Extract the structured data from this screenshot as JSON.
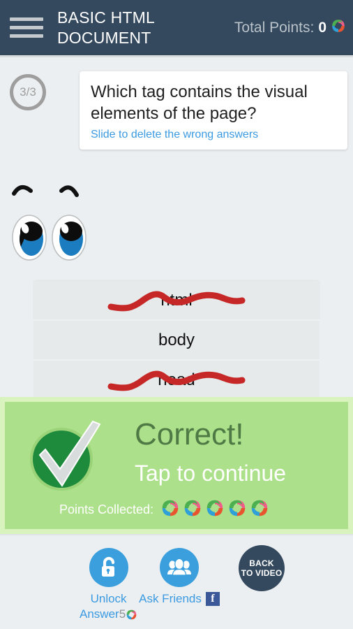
{
  "header": {
    "menu_icon": "hamburger-menu-icon",
    "title": "BASIC HTML DOCUMENT",
    "points_label": "Total Points:",
    "points_value": "0",
    "points_icon": "swirl-points-icon",
    "background_color": "#34495e"
  },
  "question": {
    "progress": "3/3",
    "text": "Which tag contains the visual elements of the page?",
    "hint": "Slide to delete the wrong answers",
    "hint_color": "#3b9ae1"
  },
  "character": {
    "face_icon": "cartoon-eyes-face"
  },
  "answers": [
    {
      "label": "html",
      "struck": true
    },
    {
      "label": "body",
      "struck": false
    },
    {
      "label": "head",
      "struck": true
    }
  ],
  "result_banner": {
    "icon": "green-check-badge-icon",
    "title": "Correct!",
    "subtitle": "Tap to continue",
    "points_collected_label": "Points Collected:",
    "points_collected_count": 5,
    "title_color": "#4f7a45",
    "panel_color": "#ace08a",
    "border_color": "#d8f3bd"
  },
  "bottom_actions": [
    {
      "id": "unlock-answer",
      "icon": "open-padlock-icon",
      "label_line1": "Unlock",
      "label_line2": "Answer",
      "cost": "5",
      "cost_icon": "swirl-points-icon",
      "circle_color": "#3a9fdc"
    },
    {
      "id": "ask-friends",
      "icon": "people-group-icon",
      "label": "Ask Friends",
      "badge_icon": "facebook-icon",
      "badge_letter": "f",
      "circle_color": "#3a9fdc"
    },
    {
      "id": "back-to-video",
      "label_line1": "BACK",
      "label_line2": "TO VIDEO",
      "circle_color": "#34495e"
    }
  ]
}
